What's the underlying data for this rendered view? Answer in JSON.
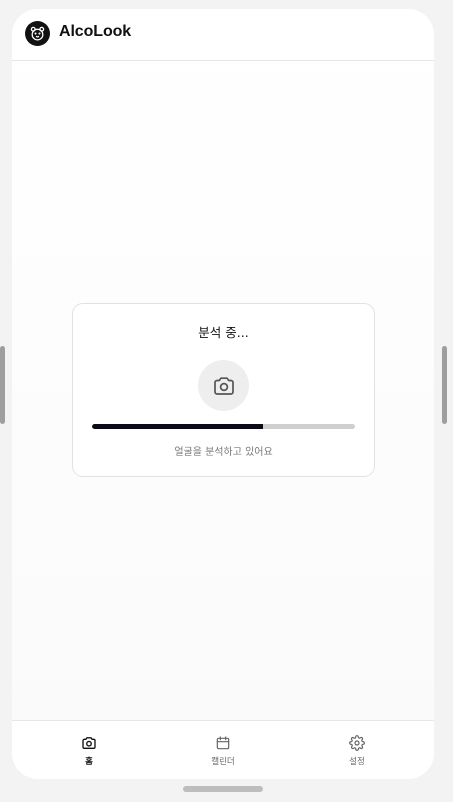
{
  "app": {
    "title": "AlcoLook",
    "logo_icon": "bear-face-icon"
  },
  "analysis": {
    "title": "분석 중...",
    "subtitle": "얼굴을 분석하고 있어요",
    "icon": "camera-icon",
    "progress": 0.65
  },
  "tabs": [
    {
      "label": "홈",
      "icon": "camera-icon",
      "active": true
    },
    {
      "label": "캘린더",
      "icon": "calendar-icon",
      "active": false
    },
    {
      "label": "설정",
      "icon": "gear-icon",
      "active": false
    }
  ],
  "colors": {
    "accent": "#0b0b15",
    "track": "#cfcfcf",
    "card_border": "#e2e2e2"
  }
}
